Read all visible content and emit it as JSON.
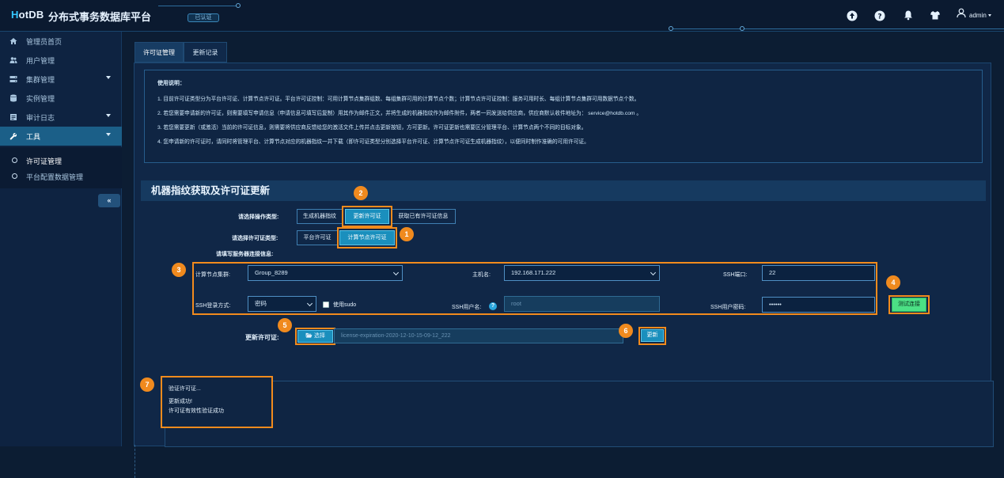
{
  "header": {
    "logo_prefix": "H",
    "logo_text": "otDB",
    "app_title": "分布式事务数据库平台",
    "auth_badge": "已认证",
    "user": "admin"
  },
  "sidebar": {
    "items": [
      {
        "label": "管理员首页",
        "icon": "home-icon"
      },
      {
        "label": "用户管理",
        "icon": "users-icon"
      },
      {
        "label": "集群管理",
        "icon": "cluster-icon",
        "expandable": true
      },
      {
        "label": "实例管理",
        "icon": "database-icon"
      },
      {
        "label": "审计日志",
        "icon": "log-icon",
        "expandable": true
      },
      {
        "label": "工具",
        "icon": "wrench-icon",
        "expandable": true,
        "active": true
      }
    ],
    "submenu": [
      {
        "label": "许可证管理",
        "current": true
      },
      {
        "label": "平台配置数据管理"
      }
    ],
    "collapse_label": "«"
  },
  "tabs": [
    {
      "label": "许可证管理",
      "active": true
    },
    {
      "label": "更新记录"
    }
  ],
  "notice": {
    "title": "使用说明：",
    "lines": [
      "1. 目前许可证类型分为平台许可证、计算节点许可证。平台许可证控制：可用计算节点集群组数、每组集群可用的计算节点个数；计算节点许可证控制：服务可用时长、每组计算节点集群可用数据节点个数。",
      "2. 若您需要申请新的许可证，则需要填写申请信息（申请信息可填写后复制）用其作为邮件正文，并将生成的机器指纹作为邮件附件，两者一同发送给供应商，供应商默认收件地址为： service@hotdb.com 。",
      "3. 若您需要更新（或激活）当前的许可证信息，则需要将供应商反馈给您的激活文件上传并点击更新按钮，方可更新。许可证更新也需要区分管理平台、计算节点两个不同的目标对象。",
      "4. 您申请新的许可证时，请同时将管理平台、计算节点对应的机器指纹一并下载（即许可证类型分别选择平台许可证、计算节点许可证生成机器指纹），以便同时制作准确的可用许可证。"
    ]
  },
  "section": {
    "title": "机器指纹获取及许可证更新",
    "operation_label": "请选择操作类型:",
    "operation_options": [
      "生成机器指纹",
      "更新许可证",
      "获取已有许可证信息"
    ],
    "operation_selected": "更新许可证",
    "license_type_label": "请选择许可证类型:",
    "license_type_options": [
      "平台许可证",
      "计算节点许可证"
    ],
    "license_type_selected": "计算节点许可证",
    "conn_info_label": "请填写服务器连接信息:",
    "fields": {
      "cluster_label": "计算节点集群:",
      "cluster_value": "Group_8289",
      "host_label": "主机名:",
      "host_value": "192.168.171.222",
      "ssh_port_label": "SSH端口:",
      "ssh_port_value": "22",
      "login_method_label": "SSH登录方式:",
      "login_method_value": "密码",
      "use_sudo_label": "使用sudo",
      "ssh_user_label": "SSH用户名:",
      "ssh_user_value": "root",
      "ssh_password_label": "SSH用户密码:",
      "ssh_password_value": "••••••"
    },
    "test_button": "测试连接",
    "update_license_label": "更新许可证:",
    "choose_button": "选择",
    "file_name": "license-expiration-2020-12-10-15-09-12_222",
    "update_button": "更新",
    "result_lines": [
      "验证许可证...",
      "更新成功!",
      "许可证有效性验证成功"
    ],
    "badges": [
      "1",
      "2",
      "3",
      "4",
      "5",
      "6",
      "7"
    ]
  },
  "colors": {
    "accent": "#1a8fbd",
    "annotation": "#f28b1d",
    "test_button": "#4ce085"
  }
}
